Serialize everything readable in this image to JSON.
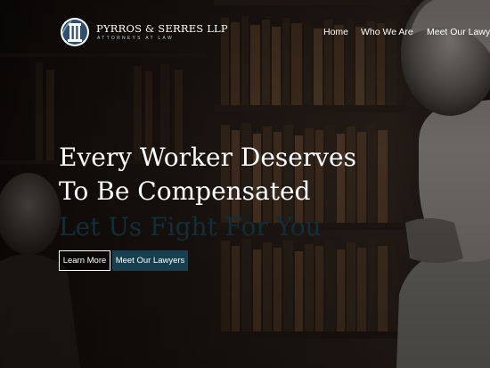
{
  "brand": {
    "name": "PYRROS & SERRES LLP",
    "tagline": "ATTORNEYS AT LAW"
  },
  "nav": {
    "items": [
      "Home",
      "Who We Are",
      "Meet Our Lawye"
    ]
  },
  "hero": {
    "line1": "Every Worker Deserves",
    "line2": "To Be Compensated",
    "line3": "Let Us Fight For You"
  },
  "buttons": {
    "learn_more": "Learn More",
    "meet_lawyers": "Meet Our Lawyers"
  },
  "colors": {
    "accent": "#173f4f",
    "tagline_dark": "#0f2f3a",
    "background": "#120f0c"
  },
  "icons": {
    "logo": "pillar-logo-icon"
  }
}
